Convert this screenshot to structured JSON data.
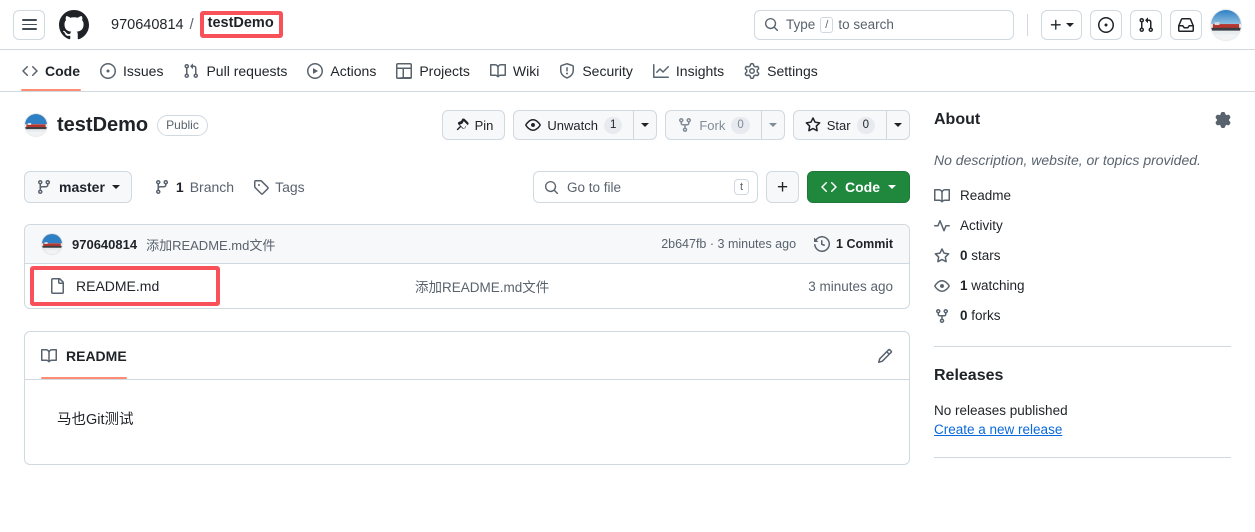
{
  "header": {
    "menu_label": "Open menu",
    "logo_name": "GitHub",
    "owner": "970640814",
    "separator": "/",
    "repo": "testDemo",
    "search": {
      "placeholder_prefix": "Type",
      "slash_key": "/",
      "placeholder_suffix": "to search"
    },
    "actions": {
      "create_new": "+",
      "issues": "issues-icon",
      "pull_requests": "pull-requests-icon",
      "inbox": "inbox-icon",
      "avatar": "user-avatar"
    }
  },
  "nav": {
    "tabs": [
      {
        "label": "Code",
        "icon": "code-icon",
        "active": true
      },
      {
        "label": "Issues",
        "icon": "issue-opened-icon",
        "active": false
      },
      {
        "label": "Pull requests",
        "icon": "git-pull-request-icon",
        "active": false
      },
      {
        "label": "Actions",
        "icon": "play-icon",
        "active": false
      },
      {
        "label": "Projects",
        "icon": "table-icon",
        "active": false
      },
      {
        "label": "Wiki",
        "icon": "book-icon",
        "active": false
      },
      {
        "label": "Security",
        "icon": "shield-icon",
        "active": false
      },
      {
        "label": "Insights",
        "icon": "graph-icon",
        "active": false
      },
      {
        "label": "Settings",
        "icon": "gear-icon",
        "active": false
      }
    ]
  },
  "repo": {
    "name": "testDemo",
    "visibility": "Public",
    "buttons": {
      "pin": "Pin",
      "unwatch": "Unwatch",
      "unwatch_count": "1",
      "fork": "Fork",
      "fork_count": "0",
      "star": "Star",
      "star_count": "0"
    }
  },
  "branchbar": {
    "branch": "master",
    "branch_count_num": "1",
    "branch_count_label": "Branch",
    "tags": "Tags",
    "gotofile_placeholder": "Go to file",
    "gotofile_key": "t",
    "add_file": "+",
    "code_button": "Code"
  },
  "filetable": {
    "commit": {
      "author": "970640814",
      "message": "添加README.md文件",
      "hash": "2b647fb",
      "dot": "·",
      "time": "3 minutes ago",
      "count": "1 Commit"
    },
    "files": [
      {
        "name": "README.md",
        "icon": "file-icon",
        "message": "添加README.md文件",
        "time": "3 minutes ago"
      }
    ]
  },
  "readme": {
    "tab_label": "README",
    "edit_label": "Edit README",
    "content": "马也Git测试"
  },
  "about": {
    "title": "About",
    "settings_label": "Edit repository metadata",
    "description": "No description, website, or topics provided.",
    "links": [
      {
        "label": "Readme",
        "icon": "book-icon"
      },
      {
        "label": "Activity",
        "icon": "pulse-icon"
      },
      {
        "label": "0 stars",
        "icon": "star-icon",
        "count": "0",
        "text": " stars"
      },
      {
        "label": "1 watching",
        "icon": "eye-icon",
        "count": "1",
        "text": " watching"
      },
      {
        "label": "0 forks",
        "icon": "fork-icon",
        "count": "0",
        "text": " forks"
      }
    ]
  },
  "releases": {
    "title": "Releases",
    "empty_text": "No releases published",
    "create_link": "Create a new release"
  },
  "colors": {
    "accent_green": "#1f883d",
    "link_blue": "#0969da",
    "annotation_red": "#f8515a",
    "tab_underline": "#fd8c73",
    "border": "#d1d9e0",
    "muted_text": "#59636e",
    "subtle_bg": "#f6f8fa"
  }
}
